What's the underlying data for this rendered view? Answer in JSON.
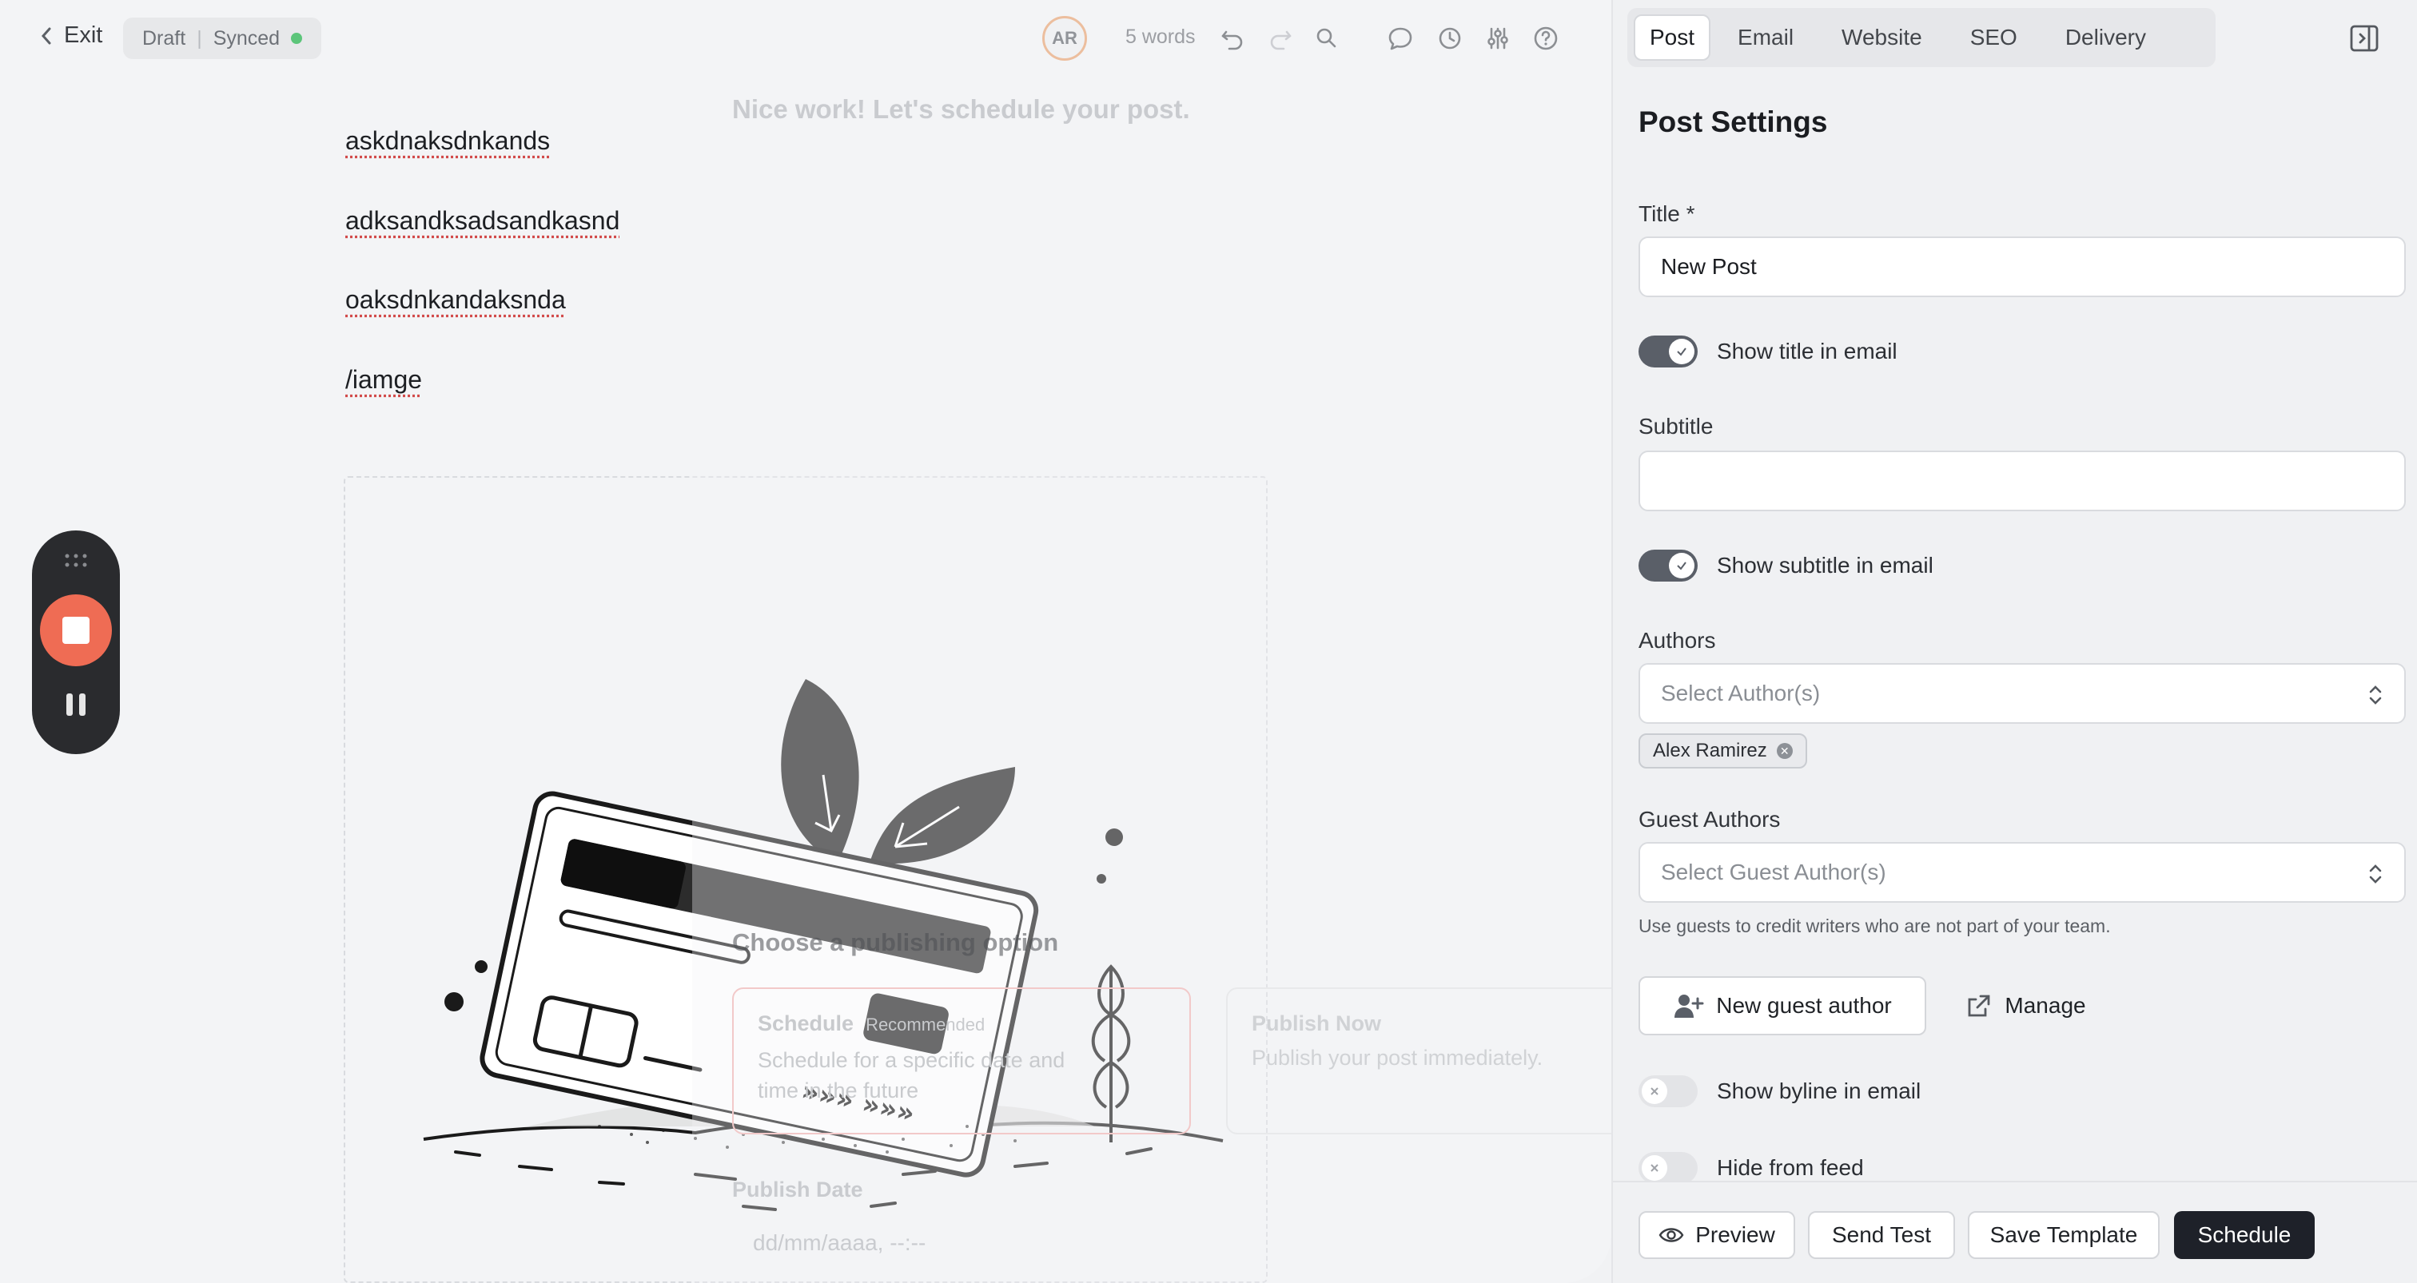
{
  "topbar": {
    "exit_label": "Exit",
    "status_draft": "Draft",
    "status_synced": "Synced",
    "avatar_initials": "AR",
    "word_count": "5 words"
  },
  "editor": {
    "paragraphs": [
      "askdnaksdnkands",
      "adksandksadsandkasnd",
      "oaksdnkandaksnda",
      "/iamge"
    ],
    "ghost": {
      "title": "Nice work! Let's schedule your post.",
      "choose": "Choose a publishing option",
      "schedule_title": "Schedule",
      "schedule_badge": "Recommended",
      "schedule_desc": "Schedule for a specific date and time in the future",
      "publish_title": "Publish Now",
      "publish_desc": "Publish your post immediately.",
      "date_label": "Publish Date",
      "date_placeholder": "dd/mm/aaaa, --:--"
    }
  },
  "panel": {
    "tabs": [
      "Post",
      "Email",
      "Website",
      "SEO",
      "Delivery"
    ],
    "active_tab": "Post",
    "title": "Post Settings",
    "title_label": "Title *",
    "title_value": "New Post",
    "show_title_label": "Show title in email",
    "subtitle_label": "Subtitle",
    "subtitle_value": "",
    "show_subtitle_label": "Show subtitle in email",
    "authors_label": "Authors",
    "authors_placeholder": "Select Author(s)",
    "author_chip": "Alex Ramirez",
    "guest_authors_label": "Guest Authors",
    "guest_authors_placeholder": "Select Guest Author(s)",
    "guest_hint": "Use guests to credit writers who are not part of your team.",
    "new_guest_label": "New guest author",
    "manage_label": "Manage",
    "show_byline_label": "Show byline in email",
    "hide_feed_label": "Hide from feed",
    "toggles": {
      "show_title": true,
      "show_subtitle": true,
      "show_byline": false,
      "hide_from_feed": false
    }
  },
  "footer": {
    "preview": "Preview",
    "send_test": "Send Test",
    "save_template": "Save Template",
    "schedule": "Schedule"
  },
  "colors": {
    "accent_record": "#ef6c54",
    "synced_dot": "#5cc57a",
    "primary_dark": "#1e2129"
  }
}
